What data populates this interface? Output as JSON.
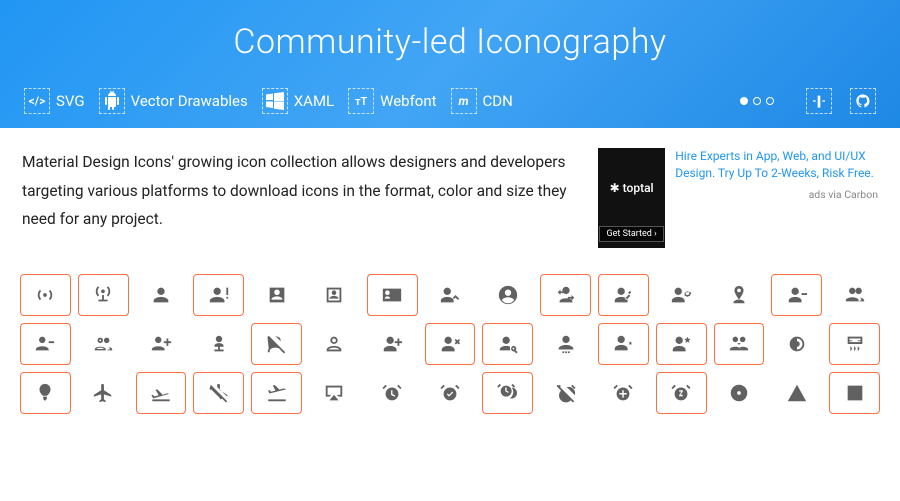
{
  "hero": {
    "title": "Community-led Iconography",
    "formats": [
      {
        "label": "SVG",
        "icon": "code"
      },
      {
        "label": "Vector Drawables",
        "icon": "android"
      },
      {
        "label": "XAML",
        "icon": "windows"
      },
      {
        "label": "Webfont",
        "icon": "text"
      },
      {
        "label": "CDN",
        "icon": "m"
      }
    ]
  },
  "intro": {
    "text": "Material Design Icons' growing icon collection allows designers and developers targeting various platforms to download icons in the format, color and size they need for any project."
  },
  "ad": {
    "brand": "✱ toptal",
    "cta": "Get Started  ›",
    "copy": "Hire Experts in App, Web, and UI/UX Design. Try Up To 2-Weeks, Risk Free.",
    "via": "ads via Carbon"
  },
  "icons": [
    {
      "name": "access-point",
      "hl": true
    },
    {
      "name": "access-point-network",
      "hl": true
    },
    {
      "name": "account",
      "hl": false
    },
    {
      "name": "account-alert",
      "hl": true
    },
    {
      "name": "account-box",
      "hl": false
    },
    {
      "name": "account-box-outline",
      "hl": false
    },
    {
      "name": "account-card-details",
      "hl": true
    },
    {
      "name": "account-check",
      "hl": false
    },
    {
      "name": "account-circle",
      "hl": false
    },
    {
      "name": "account-convert",
      "hl": true
    },
    {
      "name": "account-edit",
      "hl": true
    },
    {
      "name": "account-key",
      "hl": false
    },
    {
      "name": "account-location",
      "hl": false
    },
    {
      "name": "account-minus",
      "hl": true
    },
    {
      "name": "account-multiple",
      "hl": false
    },
    {
      "name": "account-multiple-minus",
      "hl": true
    },
    {
      "name": "account-multiple-outline",
      "hl": false
    },
    {
      "name": "account-multiple-plus",
      "hl": false
    },
    {
      "name": "account-network",
      "hl": false
    },
    {
      "name": "account-off",
      "hl": true
    },
    {
      "name": "account-outline",
      "hl": false
    },
    {
      "name": "account-plus",
      "hl": false
    },
    {
      "name": "account-remove",
      "hl": true
    },
    {
      "name": "account-search",
      "hl": true
    },
    {
      "name": "account-settings",
      "hl": false
    },
    {
      "name": "account-settings-variant",
      "hl": true
    },
    {
      "name": "account-star",
      "hl": true
    },
    {
      "name": "account-switch",
      "hl": true
    },
    {
      "name": "adjust",
      "hl": false
    },
    {
      "name": "air-conditioner",
      "hl": true
    },
    {
      "name": "airballoon",
      "hl": true
    },
    {
      "name": "airplane",
      "hl": false
    },
    {
      "name": "airplane-landing",
      "hl": true
    },
    {
      "name": "airplane-off",
      "hl": true
    },
    {
      "name": "airplane-takeoff",
      "hl": true
    },
    {
      "name": "airplay",
      "hl": false
    },
    {
      "name": "alarm",
      "hl": false
    },
    {
      "name": "alarm-check",
      "hl": false
    },
    {
      "name": "alarm-multiple",
      "hl": true
    },
    {
      "name": "alarm-off",
      "hl": false
    },
    {
      "name": "alarm-plus",
      "hl": false
    },
    {
      "name": "alarm-snooze",
      "hl": true
    },
    {
      "name": "album",
      "hl": false
    },
    {
      "name": "alert",
      "hl": false
    },
    {
      "name": "alert-box",
      "hl": true
    }
  ]
}
